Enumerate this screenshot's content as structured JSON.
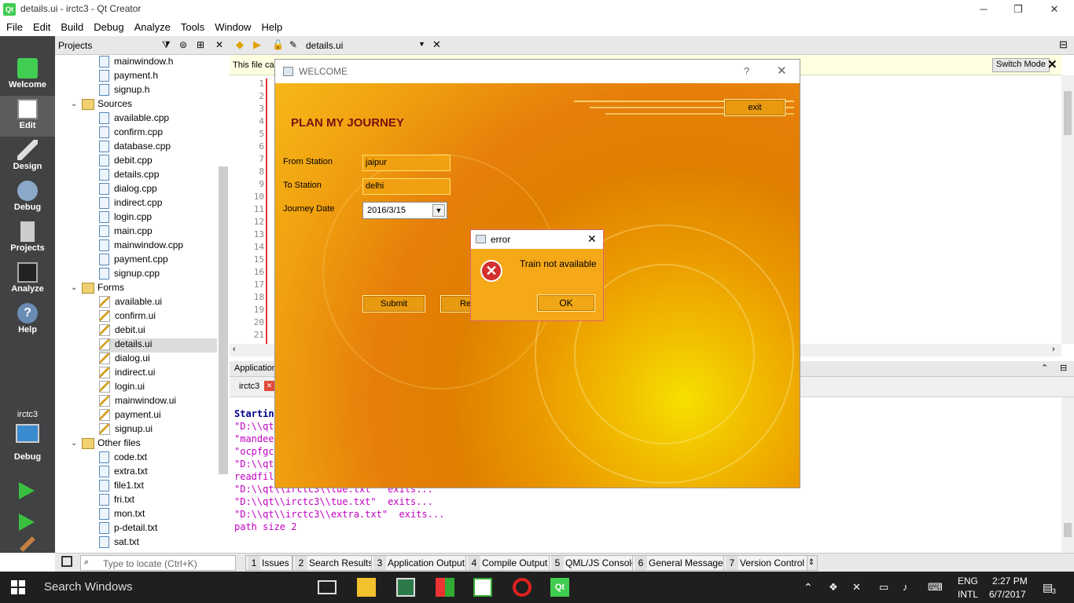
{
  "window": {
    "title": "details.ui - irctc3 - Qt Creator",
    "logo": "Qt"
  },
  "menu": [
    "File",
    "Edit",
    "Build",
    "Debug",
    "Analyze",
    "Tools",
    "Window",
    "Help"
  ],
  "modes": [
    {
      "label": "Welcome",
      "icon": "qt-logo-icon"
    },
    {
      "label": "Edit",
      "icon": "edit-document-icon"
    },
    {
      "label": "Design",
      "icon": "design-pencil-icon"
    },
    {
      "label": "Debug",
      "icon": "debug-bug-icon"
    },
    {
      "label": "Projects",
      "icon": "projects-icon"
    },
    {
      "label": "Analyze",
      "icon": "analyze-scope-icon"
    },
    {
      "label": "Help",
      "icon": "help-icon"
    }
  ],
  "kit": {
    "project": "irctc3",
    "config": "Debug"
  },
  "projects": {
    "header": "Projects",
    "tree": [
      {
        "label": "mainwindow.h",
        "type": "file"
      },
      {
        "label": "payment.h",
        "type": "file"
      },
      {
        "label": "signup.h",
        "type": "file"
      },
      {
        "label": "Sources",
        "type": "folder"
      },
      {
        "label": "available.cpp",
        "type": "file"
      },
      {
        "label": "confirm.cpp",
        "type": "file"
      },
      {
        "label": "database.cpp",
        "type": "file"
      },
      {
        "label": "debit.cpp",
        "type": "file"
      },
      {
        "label": "details.cpp",
        "type": "file"
      },
      {
        "label": "dialog.cpp",
        "type": "file"
      },
      {
        "label": "indirect.cpp",
        "type": "file"
      },
      {
        "label": "login.cpp",
        "type": "file"
      },
      {
        "label": "main.cpp",
        "type": "file"
      },
      {
        "label": "mainwindow.cpp",
        "type": "file"
      },
      {
        "label": "payment.cpp",
        "type": "file"
      },
      {
        "label": "signup.cpp",
        "type": "file"
      },
      {
        "label": "Forms",
        "type": "folder"
      },
      {
        "label": "available.ui",
        "type": "ui"
      },
      {
        "label": "confirm.ui",
        "type": "ui"
      },
      {
        "label": "debit.ui",
        "type": "ui"
      },
      {
        "label": "details.ui",
        "type": "ui",
        "selected": true
      },
      {
        "label": "dialog.ui",
        "type": "ui"
      },
      {
        "label": "indirect.ui",
        "type": "ui"
      },
      {
        "label": "login.ui",
        "type": "ui"
      },
      {
        "label": "mainwindow.ui",
        "type": "ui"
      },
      {
        "label": "payment.ui",
        "type": "ui"
      },
      {
        "label": "signup.ui",
        "type": "ui"
      },
      {
        "label": "Other files",
        "type": "folder"
      },
      {
        "label": "code.txt",
        "type": "file"
      },
      {
        "label": "extra.txt",
        "type": "file"
      },
      {
        "label": "file1.txt",
        "type": "file"
      },
      {
        "label": "fri.txt",
        "type": "file"
      },
      {
        "label": "mon.txt",
        "type": "file"
      },
      {
        "label": "p-detail.txt",
        "type": "file"
      },
      {
        "label": "sat.txt",
        "type": "file"
      }
    ]
  },
  "editor": {
    "file": "details.ui",
    "info": "This file car",
    "switch_mode": "Switch Mode",
    "line_numbers": [
      "1",
      "2",
      "3",
      "4",
      "5",
      "6",
      "7",
      "8",
      "9",
      "10",
      "11",
      "12",
      "13",
      "14",
      "15",
      "16",
      "17",
      "18",
      "19",
      "20",
      "21"
    ]
  },
  "output": {
    "header": "Application",
    "tab": "irctc3",
    "lines": [
      {
        "text": "Startin",
        "color": "#00008b",
        "bold": true
      },
      {
        "text": "\"D:\\\\qt",
        "color": "#c000c0"
      },
      {
        "text": "\"mandee",
        "color": "#c000c0"
      },
      {
        "text": "\"ocpfgc",
        "color": "#c000c0"
      },
      {
        "text": "\"D:\\\\qt",
        "color": "#c000c0"
      },
      {
        "text": "readfil",
        "color": "#c000c0"
      },
      {
        "text": "\"D:\\\\qt\\\\irctc3\\\\tue.txt\"  exits...",
        "color": "#c000c0"
      },
      {
        "text": "\"D:\\\\qt\\\\irctc3\\\\tue.txt\"  exits...",
        "color": "#c000c0"
      },
      {
        "text": "\"D:\\\\qt\\\\irctc3\\\\extra.txt\"  exits...",
        "color": "#c000c0"
      },
      {
        "text": "path size 2",
        "color": "#c000c0"
      }
    ]
  },
  "statusbar": {
    "locator_placeholder": "Type to locate (Ctrl+K)",
    "panes": [
      {
        "num": "1",
        "label": "Issues"
      },
      {
        "num": "2",
        "label": "Search Results"
      },
      {
        "num": "3",
        "label": "Application Output"
      },
      {
        "num": "4",
        "label": "Compile Output"
      },
      {
        "num": "5",
        "label": "QML/JS Console"
      },
      {
        "num": "6",
        "label": "General Messages"
      },
      {
        "num": "7",
        "label": "Version Control"
      }
    ]
  },
  "welcome_dialog": {
    "title": "WELCOME",
    "help": "?",
    "heading": "PLAN MY JOURNEY",
    "exit": "exit",
    "from_label": "From Station",
    "from_value": "jaipur",
    "to_label": "To Station",
    "to_value": "delhi",
    "date_label": "Journey Date",
    "date_value": "2016/3/15",
    "submit": "Submit",
    "reset_partial": "Re"
  },
  "error_dialog": {
    "title": "error",
    "message": "Train not available",
    "ok": "OK"
  },
  "taskbar": {
    "search": "Search Windows",
    "lang1": "ENG",
    "lang2": "INTL",
    "time": "2:27 PM",
    "date": "6/7/2017",
    "notif_count": "3"
  },
  "colors": {
    "mode_bar": "#404244",
    "accent_qt": "#41cd52",
    "error_red": "#d32f2f",
    "dialog_orange": "#e67f0a"
  }
}
